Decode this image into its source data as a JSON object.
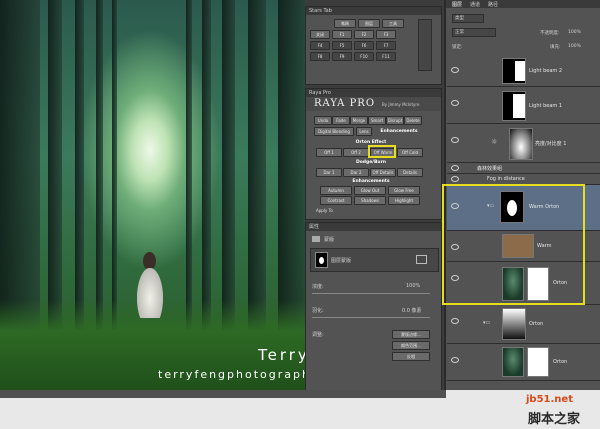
{
  "photo": {
    "watermark_name": "Terry F",
    "watermark_site": "terryfengphotography.lofter.com"
  },
  "small_panel": {
    "title": "Stars Tab",
    "rows": [
      [
        "笔刷",
        "图层",
        "工具"
      ],
      [
        "关闭",
        "F1",
        "F2",
        "F3"
      ],
      [
        "F4",
        "F5",
        "F6",
        "F7"
      ],
      [
        "F8",
        "F9",
        "F10",
        "F11"
      ]
    ]
  },
  "raya": {
    "header": "Raya Pro",
    "title": "RAYA PRO",
    "subtitle": "By Jimmy McIntyre",
    "tabs": [
      "Undo",
      "Fade",
      "Merge",
      "Smart",
      "Disrupt",
      "Delete"
    ],
    "row2": [
      "Digital Blending",
      "Lens",
      "Enhancements"
    ],
    "orton_label": "Orton Effect",
    "orton_buttons": [
      "Off 1",
      "Off 2",
      "Off Warm",
      "Off Cold"
    ],
    "dodge_label": "Dodge/Burn",
    "dodge_buttons": [
      "Dar 1",
      "Dar 2",
      "Off Details",
      "Details"
    ],
    "enh_label": "Enhancements",
    "enh_buttons": [
      "Autumn",
      "Glow Out",
      "Glow Free",
      "Contrast",
      "Shadows",
      "Highlight"
    ],
    "apply_label": "Apply To"
  },
  "properties": {
    "header": "属性",
    "mask_label": "蒙版",
    "layer_mask_label": "图层蒙版",
    "density_label": "浓度:",
    "density_value": "100%",
    "feather_label": "羽化:",
    "feather_value": "0.0 像素",
    "refine_label": "调整:",
    "btn_edge": "蒙版边缘...",
    "btn_color": "颜色范围...",
    "btn_invert": "反相"
  },
  "layers_panel": {
    "tabs": [
      "图层",
      "通道",
      "路径"
    ],
    "kind_label": "类型",
    "blend_mode": "正常",
    "opacity_label": "不透明度:",
    "opacity_value": "100%",
    "lock_label": "锁定:",
    "fill_label": "填充:",
    "fill_value": "100%",
    "layers": [
      {
        "name": "Light beam 2"
      },
      {
        "name": "Light beam 1"
      },
      {
        "name": "亮度/对比度 1"
      },
      {
        "name": "森林效果组"
      },
      {
        "name": "Fog in distance"
      },
      {
        "name": "Warm Orton"
      },
      {
        "name": "Warm"
      },
      {
        "name": "Orton"
      },
      {
        "name": "Orton"
      },
      {
        "name": "Orton"
      }
    ]
  },
  "site_badge": {
    "domain": "jb51.net",
    "name": "脚本之家"
  }
}
